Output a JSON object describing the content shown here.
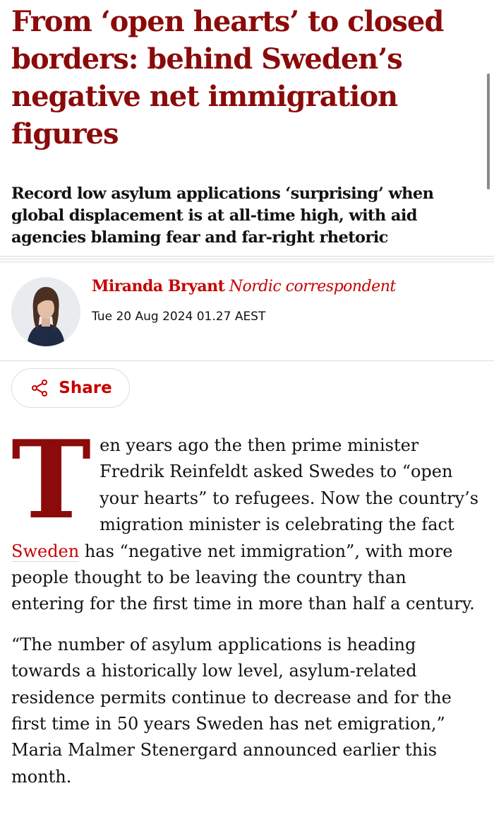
{
  "article": {
    "headline": "From ‘open hearts’ to closed borders: behind Sweden’s negative net immigration figures",
    "standfirst": "Record low asylum applications ‘surprising’ when global displacement is at all-time high, with aid agencies blaming fear and far-right rhetoric",
    "author_name": "Miranda Bryant",
    "author_role": "Nordic correspondent",
    "date": "Tue 20 Aug 2024 01.27 AEST",
    "share_label": "Share",
    "body": {
      "p1_dropcap": "T",
      "p1_a": "en years ago the then prime minister Fredrik Reinfeldt asked Swedes to “open your hearts” to refugees. Now the country’s migration minister is celebrating the fact ",
      "p1_link": "Sweden",
      "p1_b": " has “negative net immigration”, with more people thought to be leaving the country than entering for the first time in more than half a century.",
      "p2": "“The number of asylum applications is heading towards a historically low level, asylum-related residence permits continue to decrease and for the first time in 50 years Sweden has net emigration,” Maria Malmer Stenergard announced earlier this month."
    }
  },
  "colors": {
    "headline": "#8b0a0a",
    "accent": "#c70000",
    "text": "#121212",
    "rule": "#dcdcdc"
  },
  "icons": {
    "share": "share-icon"
  }
}
